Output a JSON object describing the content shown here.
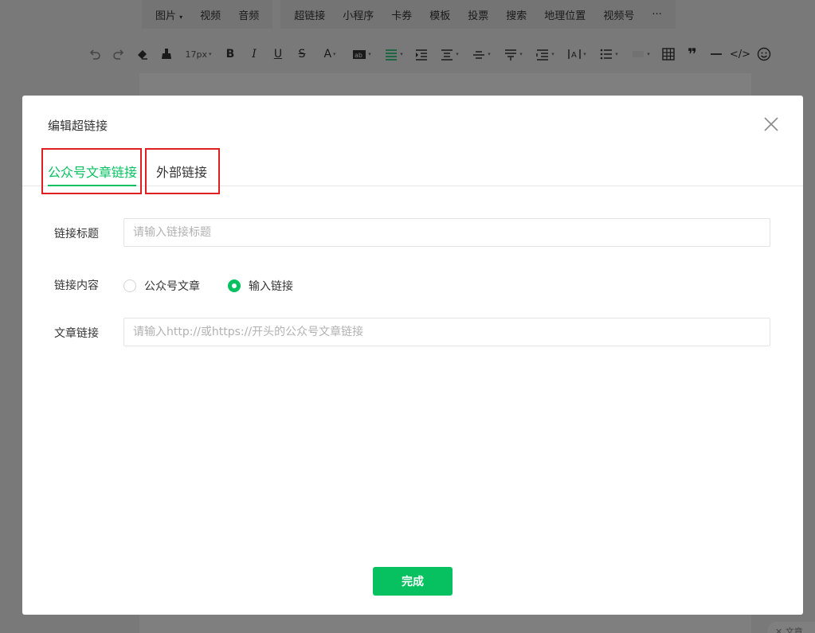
{
  "editor": {
    "insert_menu": [
      {
        "name": "insert-image",
        "label": "图片",
        "has_dropdown": true
      },
      {
        "name": "insert-video",
        "label": "视频"
      },
      {
        "name": "insert-audio",
        "label": "音频"
      }
    ],
    "insert_menu_2": [
      {
        "name": "insert-hyperlink",
        "label": "超链接"
      },
      {
        "name": "insert-mini-program",
        "label": "小程序"
      },
      {
        "name": "insert-card-coupon",
        "label": "卡券"
      },
      {
        "name": "insert-template",
        "label": "模板"
      },
      {
        "name": "insert-vote",
        "label": "投票"
      },
      {
        "name": "insert-search",
        "label": "搜索"
      },
      {
        "name": "insert-location",
        "label": "地理位置"
      },
      {
        "name": "insert-channels",
        "label": "视频号"
      },
      {
        "name": "insert-more",
        "label": "···"
      }
    ],
    "font_size": "17px",
    "format_icons": [
      "undo-icon",
      "redo-icon",
      "eraser-icon",
      "format-brush-icon",
      "bold-icon",
      "italic-icon",
      "underline-icon",
      "strikethrough-icon",
      "font-color-icon",
      "background-color-icon",
      "align-icon",
      "indent-icon",
      "line-height-icon",
      "letter-spacing-icon",
      "paragraph-spacing-icon",
      "list-icon",
      "table-icon",
      "quote-icon",
      "divider-icon",
      "code-icon",
      "emoji-icon"
    ],
    "side_chip_label": "文章"
  },
  "dialog": {
    "title": "编辑超链接",
    "tabs": [
      {
        "label": "公众号文章链接",
        "active": true
      },
      {
        "label": "外部链接",
        "active": false
      }
    ],
    "fields": {
      "title_label": "链接标题",
      "title_placeholder": "请输入链接标题",
      "content_label": "链接内容",
      "radio_article": "公众号文章",
      "radio_input_link": "输入链接",
      "selected_option": "输入链接",
      "link_label": "文章链接",
      "link_placeholder": "请输入http://或https://开头的公众号文章链接"
    },
    "done_button": "完成"
  },
  "colors": {
    "accent": "#07c160",
    "highlight_box": "#e02020"
  }
}
